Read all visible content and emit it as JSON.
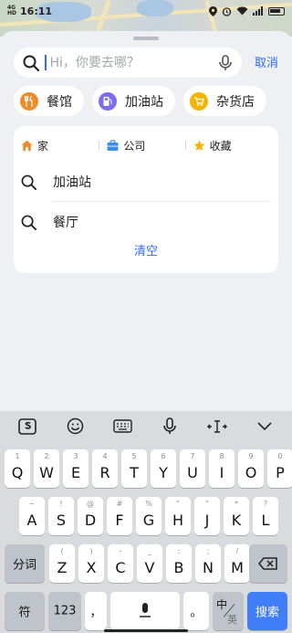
{
  "status_bar": {
    "network": "4G",
    "network2": "HD",
    "time": "16:11",
    "battery": "24%"
  },
  "search": {
    "placeholder": "Hi，你要去哪？",
    "cancel_label": "取消"
  },
  "categories": [
    {
      "label": "餐馆",
      "icon": "restaurant-icon",
      "color": "#f08a24"
    },
    {
      "label": "加油站",
      "icon": "gas-station-icon",
      "color": "#7b6cf0"
    },
    {
      "label": "杂货店",
      "icon": "grocery-icon",
      "color": "#f5b400"
    }
  ],
  "quick_links": [
    {
      "label": "家",
      "icon": "home-icon",
      "color": "#f08a24"
    },
    {
      "label": "公司",
      "icon": "briefcase-icon",
      "color": "#3b8ee8"
    },
    {
      "label": "收藏",
      "icon": "star-icon",
      "color": "#f5b400"
    }
  ],
  "history": [
    {
      "label": "加油站"
    },
    {
      "label": "餐厅"
    }
  ],
  "clear_label": "清空",
  "keyboard": {
    "row1": [
      {
        "k": "Q",
        "s": "1"
      },
      {
        "k": "W",
        "s": "2"
      },
      {
        "k": "E",
        "s": "3"
      },
      {
        "k": "R",
        "s": "4"
      },
      {
        "k": "T",
        "s": "5"
      },
      {
        "k": "Y",
        "s": "6"
      },
      {
        "k": "U",
        "s": "7"
      },
      {
        "k": "I",
        "s": "8"
      },
      {
        "k": "O",
        "s": "9"
      },
      {
        "k": "P",
        "s": "0"
      }
    ],
    "row2": [
      {
        "k": "A",
        "s": "~"
      },
      {
        "k": "S",
        "s": "!"
      },
      {
        "k": "D",
        "s": "@"
      },
      {
        "k": "F",
        "s": "#"
      },
      {
        "k": "G",
        "s": "%"
      },
      {
        "k": "H",
        "s": "“"
      },
      {
        "k": "J",
        "s": "”"
      },
      {
        "k": "K",
        "s": "*"
      },
      {
        "k": "L",
        "s": "?"
      }
    ],
    "row3": [
      {
        "k": "Z",
        "s": "("
      },
      {
        "k": "X",
        "s": ")"
      },
      {
        "k": "C",
        "s": "-"
      },
      {
        "k": "V",
        "s": "_"
      },
      {
        "k": "B",
        "s": ":"
      },
      {
        "k": "N",
        "s": ";"
      },
      {
        "k": "M",
        "s": "/"
      }
    ],
    "fenci": "分词",
    "fu": "符",
    "num": "123",
    "comma": "，",
    "period": "。",
    "zhong": "中",
    "ying": "英",
    "search": "搜索",
    "colors": {
      "accent": "#2f6df6",
      "search_key": "#3f7ef7"
    }
  }
}
